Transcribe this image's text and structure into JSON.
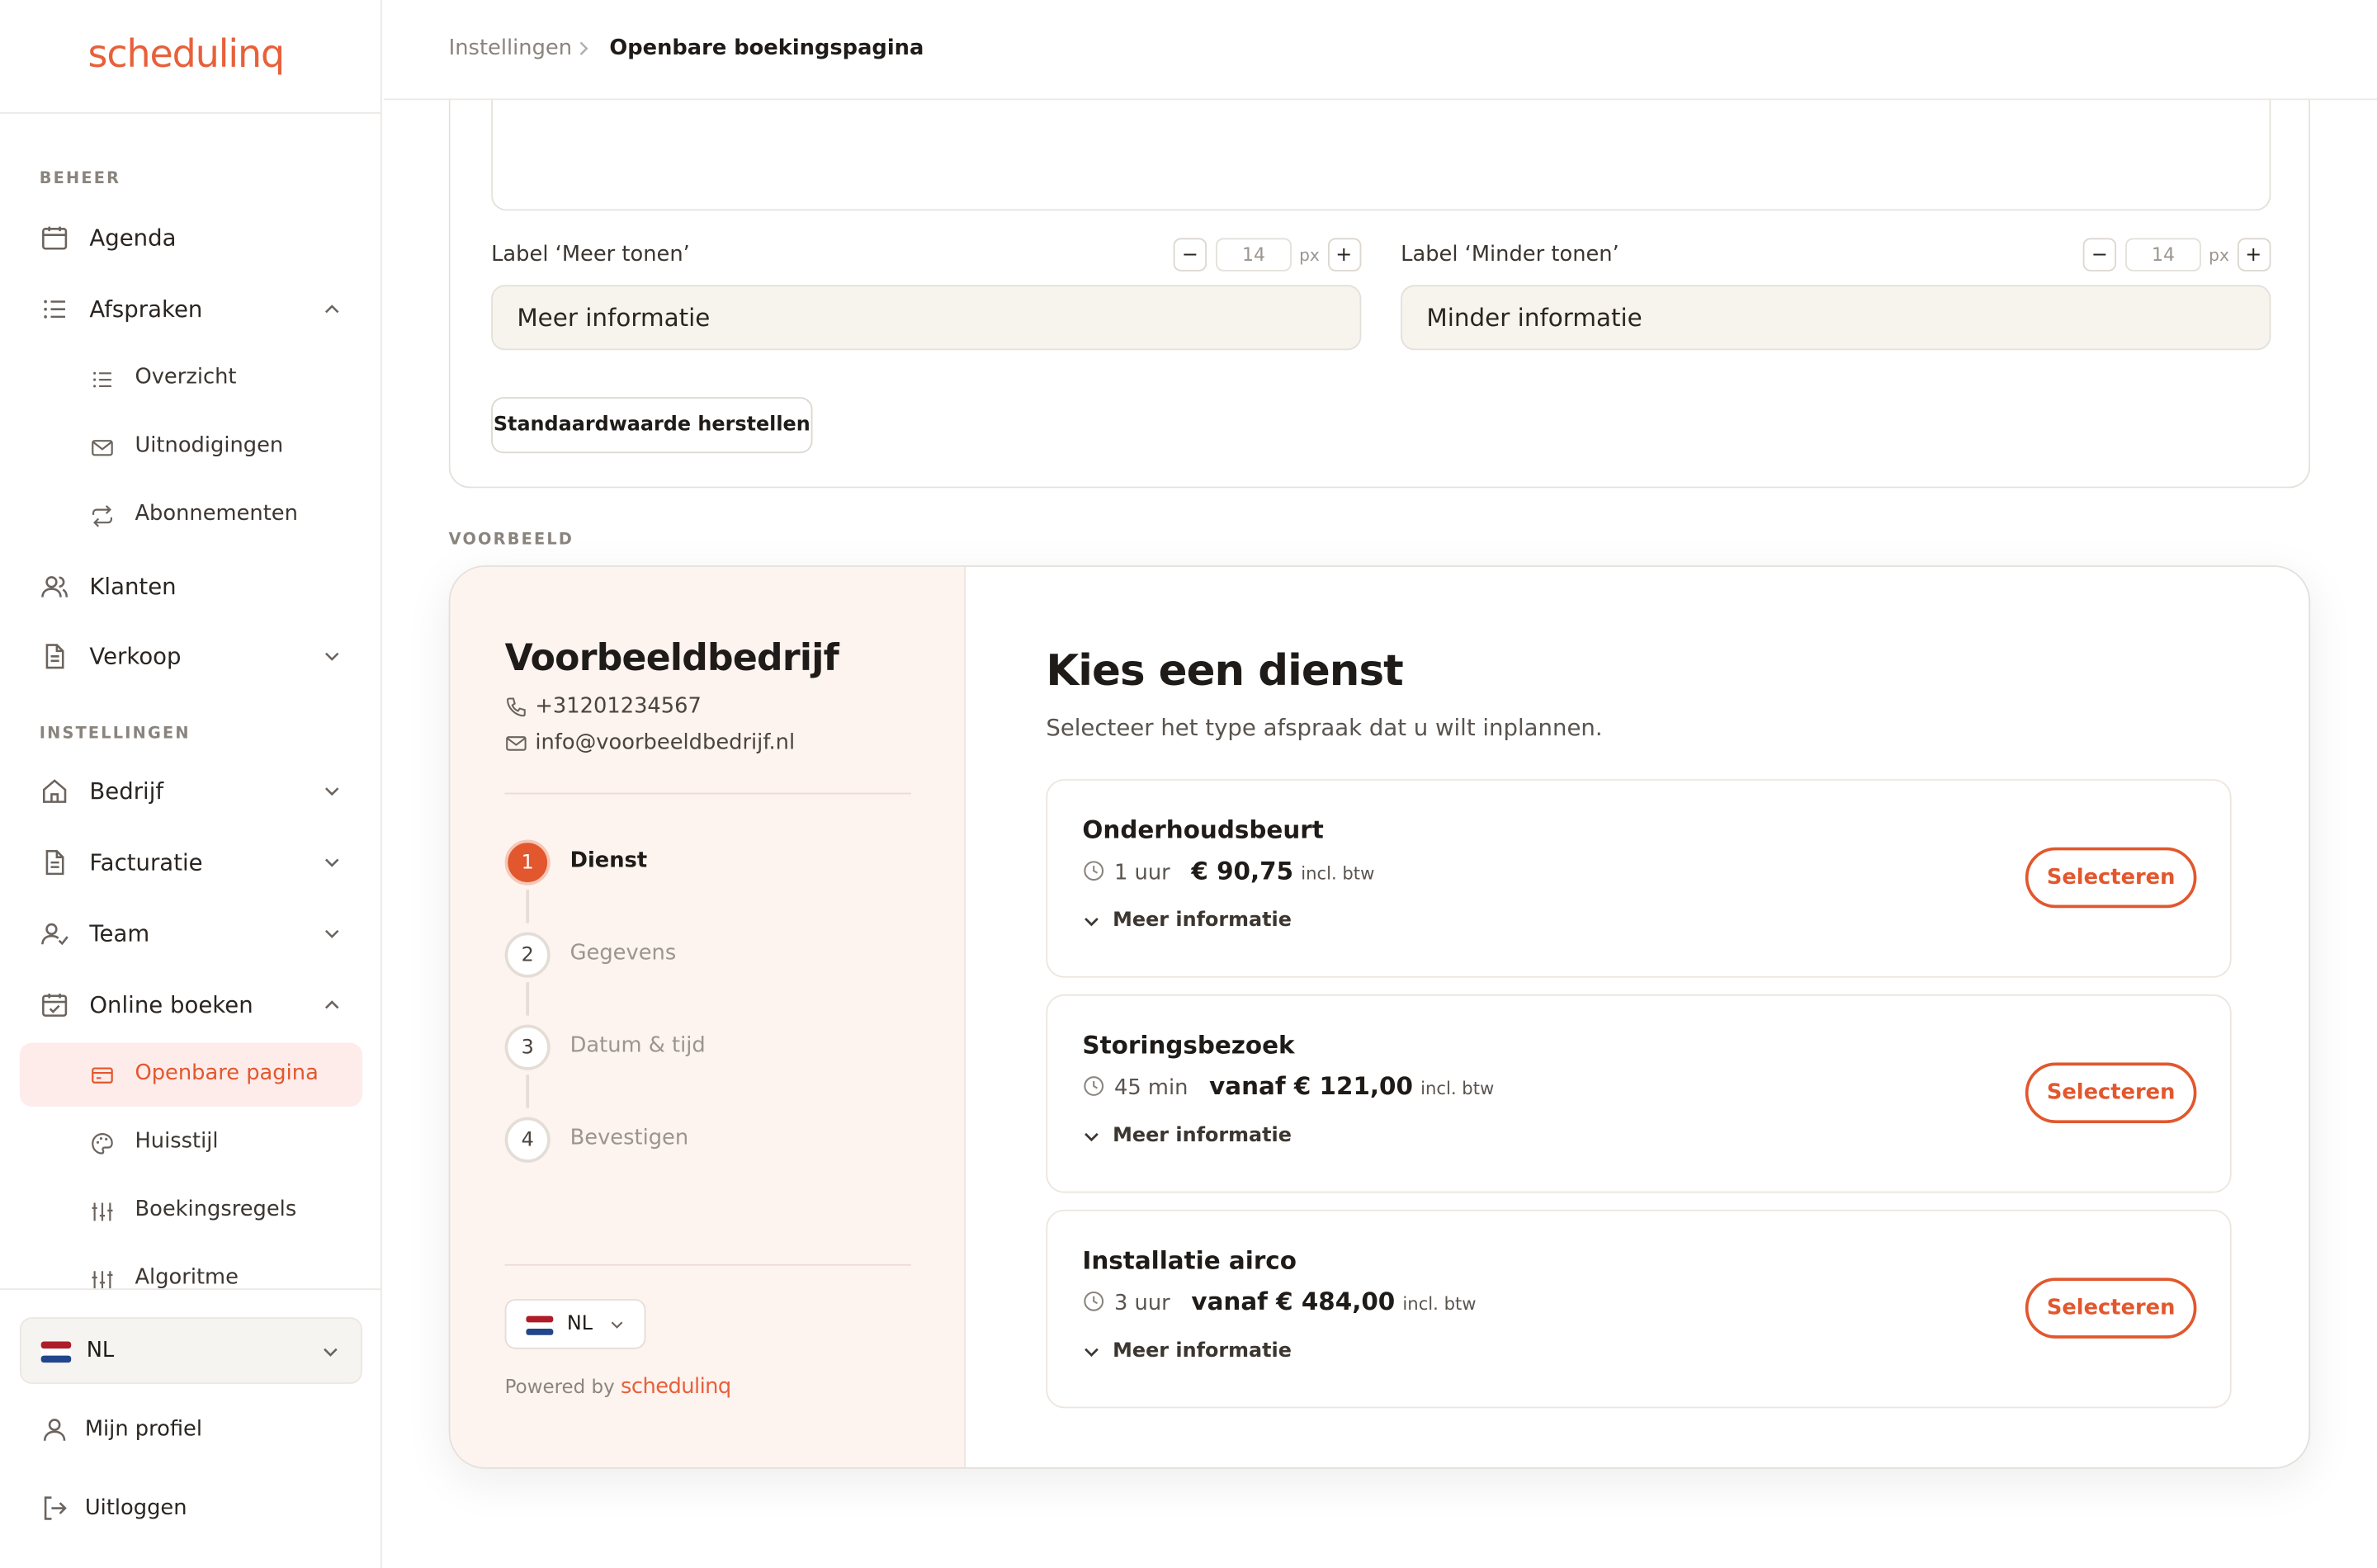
{
  "brand": {
    "logo_text": "schedulinq",
    "accent": "#e2572d"
  },
  "sidebar": {
    "section_beheer": "BEHEER",
    "section_instellingen": "INSTELLINGEN",
    "items": [
      {
        "label": "Agenda",
        "icon": "calendar-icon"
      },
      {
        "label": "Afspraken",
        "icon": "list-icon"
      },
      {
        "label": "Overzicht",
        "icon": "list-icon"
      },
      {
        "label": "Uitnodigingen",
        "icon": "mail-icon"
      },
      {
        "label": "Abonnementen",
        "icon": "repeat-icon"
      },
      {
        "label": "Klanten",
        "icon": "users-icon"
      },
      {
        "label": "Verkoop",
        "icon": "document-icon"
      },
      {
        "label": "Bedrijf",
        "icon": "home-icon"
      },
      {
        "label": "Facturatie",
        "icon": "document-icon"
      },
      {
        "label": "Team",
        "icon": "user-check-icon"
      },
      {
        "label": "Online boeken",
        "icon": "calendar-check-icon"
      },
      {
        "label": "Openbare pagina",
        "icon": "credit-card-icon"
      },
      {
        "label": "Huisstijl",
        "icon": "palette-icon"
      },
      {
        "label": "Boekingsregels",
        "icon": "sliders-icon"
      },
      {
        "label": "Algoritme",
        "icon": "sliders-icon"
      }
    ],
    "language": "NL",
    "profile": "Mijn profiel",
    "logout": "Uitloggen"
  },
  "header": {
    "breadcrumb_parent": "Instellingen",
    "breadcrumb_current": "Openbare boekingspagina"
  },
  "settings": {
    "label_more": "Label ‘Meer tonen’",
    "label_less": "Label ‘Minder tonen’",
    "size_more": "14",
    "size_less": "14",
    "unit": "px",
    "minus": "−",
    "plus": "+",
    "value_more": "Meer informatie",
    "value_less": "Minder informatie",
    "reset_label": "Standaardwaarde herstellen"
  },
  "preview": {
    "section_label": "VOORBEELD",
    "company": "Voorbeeldbedrijf",
    "phone": "+31201234567",
    "email": "info@voorbeeldbedrijf.nl",
    "steps": [
      {
        "n": "1",
        "label": "Dienst"
      },
      {
        "n": "2",
        "label": "Gegevens"
      },
      {
        "n": "3",
        "label": "Datum & tijd"
      },
      {
        "n": "4",
        "label": "Bevestigen"
      }
    ],
    "language": "NL",
    "powered_by": "Powered by",
    "title": "Kies een dienst",
    "subtitle": "Selecteer het type afspraak dat u wilt inplannen.",
    "select_label": "Selecteren",
    "more_label": "Meer informatie",
    "btw_label": "incl. btw",
    "services": [
      {
        "name": "Onderhoudsbeurt",
        "duration": "1 uur",
        "price": "€ 90,75"
      },
      {
        "name": "Storingsbezoek",
        "duration": "45 min",
        "price": "vanaf € 121,00"
      },
      {
        "name": "Installatie airco",
        "duration": "3 uur",
        "price": "vanaf € 484,00"
      }
    ]
  }
}
